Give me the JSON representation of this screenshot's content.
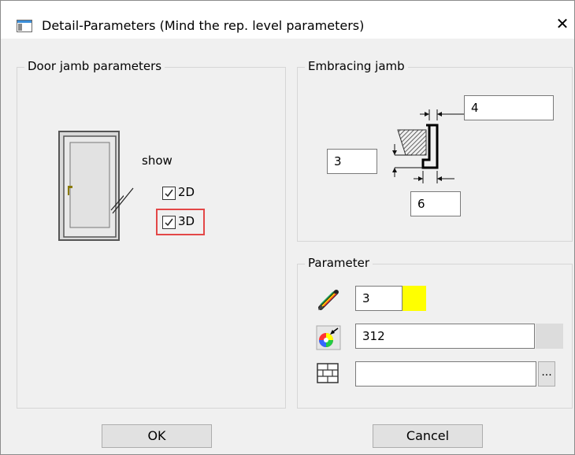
{
  "window": {
    "title": "Detail-Parameters (Mind the rep. level parameters)",
    "close_glyph": "✕"
  },
  "door_group": {
    "legend": "Door jamb parameters",
    "show_label": "show",
    "checkbox_2d": {
      "label": "2D",
      "checked": true
    },
    "checkbox_3d": {
      "label": "3D",
      "checked": true,
      "highlight_color": "#e34747"
    }
  },
  "embracing_group": {
    "legend": "Embracing jamb",
    "top_value": "4",
    "left_value": "3",
    "bottom_value": "6"
  },
  "parameter_group": {
    "legend": "Parameter",
    "pen_value": "3",
    "color_swatch": "#ffff00",
    "color_value": "312",
    "hatch_value": "",
    "browse_label": "..."
  },
  "buttons": {
    "ok": "OK",
    "cancel": "Cancel"
  },
  "icons": {
    "window": "dialog-window-icon",
    "pen": "pen-icon",
    "color": "color-wheel-icon",
    "hatch": "brick-hatch-icon"
  }
}
